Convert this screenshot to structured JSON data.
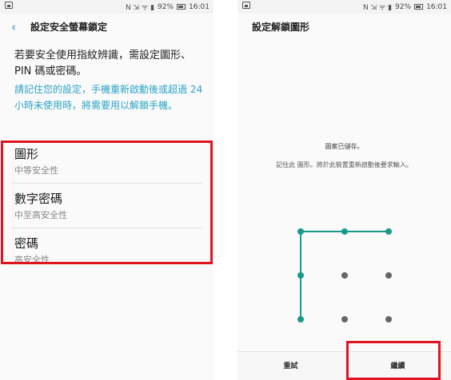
{
  "status": {
    "battery": "92%",
    "time": "16:01",
    "icons": "N ⇲ ᯤ ▮"
  },
  "left": {
    "title": "設定安全螢幕鎖定",
    "description": "若要安全使用指紋辨識，需設定圖形、PIN 碼或密碼。",
    "note": "請記住您的設定，手機重新啟動後或超過 24 小時未使用時，將需要用以解鎖手機。",
    "options": [
      {
        "title": "圖形",
        "subtitle": "中等安全性"
      },
      {
        "title": "數字密碼",
        "subtitle": "中至高安全性"
      },
      {
        "title": "密碼",
        "subtitle": "高安全性"
      }
    ]
  },
  "right": {
    "title": "設定解鎖圖形",
    "saved_text": "圖案已儲存。",
    "remember_text": "記住此 圖形。將於此裝置重新啟動後要求輸入。",
    "pattern": {
      "grid": "3x3",
      "path": [
        [
          0,
          2
        ],
        [
          0,
          1
        ],
        [
          0,
          0
        ],
        [
          1,
          0
        ],
        [
          2,
          0
        ]
      ],
      "accent_color": "#1a9a8c",
      "dot_color": "#666666"
    },
    "buttons": {
      "retry": "重試",
      "continue": "繼續"
    }
  },
  "colors": {
    "highlight": "#e0141e",
    "note": "#2aa3c7",
    "accent": "#1a9a8c"
  }
}
